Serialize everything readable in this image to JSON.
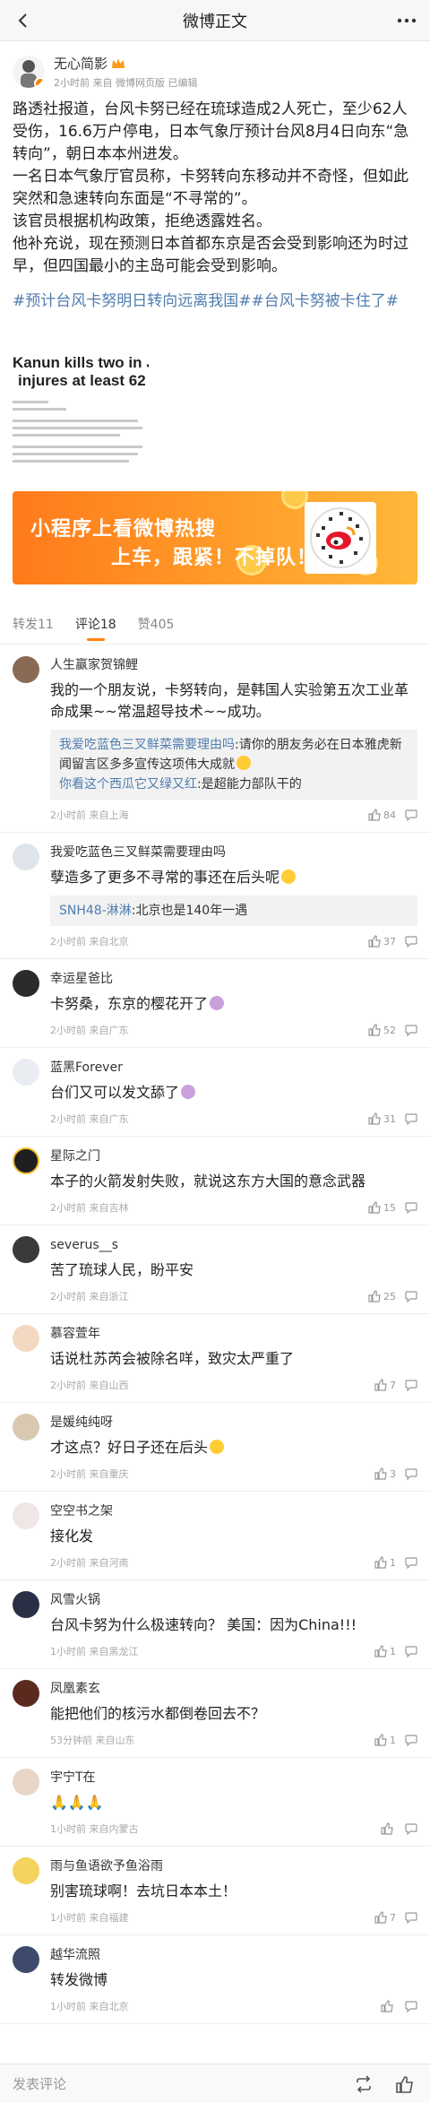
{
  "header": {
    "title": "微博正文"
  },
  "post": {
    "author": "无心简影",
    "meta": "2小时前 来自 微博网页版 已编辑",
    "paragraphs": [
      "路透社报道，台风卡努已经在琉球造成2人死亡，至少62人受伤，16.6万户停电，日本气象厅预计台风8月4日向东“急转向”，朝日本本州进发。",
      "一名日本气象厅官员称，卡努转向东移动并不奇怪，但如此突然和急速转向东面是“不寻常的”。",
      "该官员根据机构政策，拒绝透露姓名。",
      "他补充说，现在预测日本首都东京是否会受到影响还为时过早，但四国最小的主岛可能会受到影响。"
    ],
    "hashtags": "#预计台风卡努明日转向远离我国##台风卡努被卡住了#",
    "image_headline_1": "Kanun kills two in Japa",
    "image_headline_2": "injures at least 62"
  },
  "banner": {
    "line1": "小程序上看微博热搜",
    "line2": "上车，跟紧！不掉队！"
  },
  "tabs": [
    {
      "label": "转发11",
      "active": false
    },
    {
      "label": "评论18",
      "active": true
    },
    {
      "label": "赞405",
      "active": false
    }
  ],
  "comments": [
    {
      "name": "人生赢家贺锦鲤",
      "text": "我的一个朋友说，卡努转向，是韩国人实验第五次工业革命成果~~常温超导技术~~成功。",
      "replies": [
        {
          "user": "我爱吃蓝色三叉鲜菜需要理由吗",
          "text": ":请你的朋友务必在日本雅虎新闻留言区多多宣传这项伟大成就"
        },
        {
          "user": "你看这个西瓜它又绿又红",
          "text": ":是超能力部队干的"
        }
      ],
      "meta": "2小时前 来自上海",
      "likes": "84"
    },
    {
      "name": "我爱吃蓝色三叉鲜菜需要理由吗",
      "text": "孽造多了更多不寻常的事还在后头呢",
      "replies": [
        {
          "user": "SNH48-淋淋",
          "text": ":北京也是140年一遇"
        }
      ],
      "meta": "2小时前 来自北京",
      "likes": "37"
    },
    {
      "name": "幸运星爸比",
      "text": "卡努桑，东京的樱花开了",
      "meta": "2小时前 来自广东",
      "likes": "52"
    },
    {
      "name": "蓝黑Forever",
      "text": "台们又可以发文舔了",
      "meta": "2小时前 来自广东",
      "likes": "31"
    },
    {
      "name": "星际之门",
      "text": "本子的火箭发射失败，就说这东方大国的意念武器",
      "meta": "2小时前 来自吉林",
      "likes": "15"
    },
    {
      "name": "severus__s",
      "text": "苦了琉球人民，盼平安",
      "meta": "2小时前 来自浙江",
      "likes": "25"
    },
    {
      "name": "慕容萱年",
      "text": "话说杜苏芮会被除名咩，致灾太严重了",
      "meta": "2小时前 来自山西",
      "likes": "7"
    },
    {
      "name": "是媛纯纯呀",
      "text": "才这点？好日子还在后头",
      "meta": "2小时前 来自重庆",
      "likes": "3"
    },
    {
      "name": "空空书之架",
      "text": "接化发",
      "meta": "2小时前 来自河南",
      "likes": "1"
    },
    {
      "name": "风雪火锅",
      "text": "台风卡努为什么极速转向？ 美国：因为China!!!",
      "meta": "1小时前 来自黑龙江",
      "likes": "1"
    },
    {
      "name": "凤凰素玄",
      "text": "能把他们的核污水都倒卷回去不？",
      "meta": "53分钟前 来自山东",
      "likes": "1"
    },
    {
      "name": "宇宁T在",
      "text": "🙏🙏🙏",
      "meta": "1小时前 来自内蒙古",
      "likes": ""
    },
    {
      "name": "雨与鱼语欲予鱼浴雨",
      "text": "别害琉球啊！去坑日本本土！",
      "meta": "1小时前 来自福建",
      "likes": "7"
    },
    {
      "name": "越华流照",
      "text": "转发微博",
      "meta": "1小时前 来自北京",
      "likes": ""
    }
  ],
  "bottombar": {
    "placeholder": "发表评论"
  },
  "colors": {
    "accent": "#ff8200",
    "link": "#507daf",
    "banner": "#ff8a22"
  }
}
